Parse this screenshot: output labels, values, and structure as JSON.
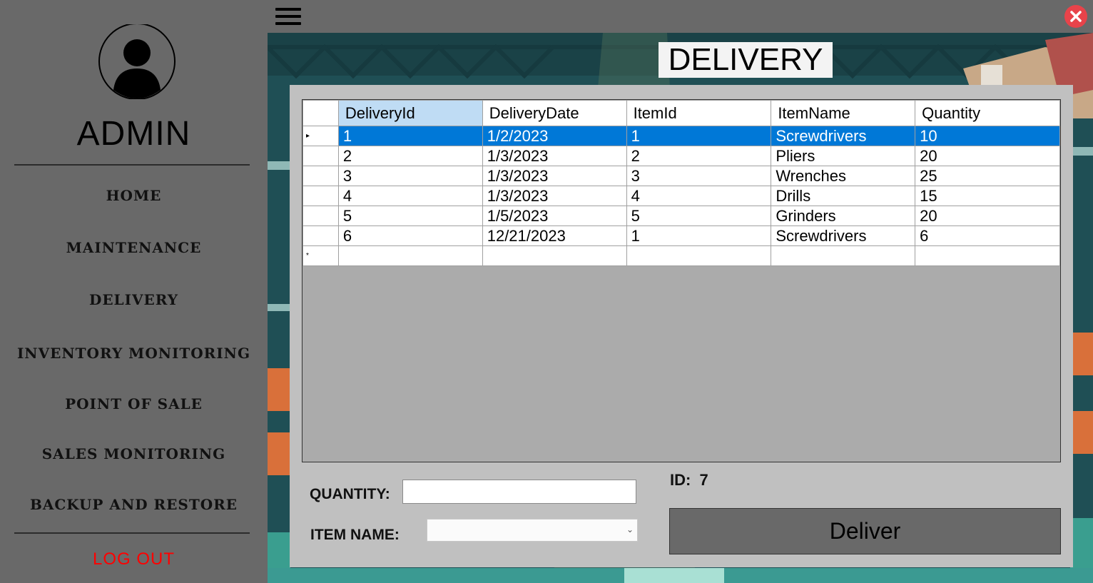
{
  "sidebar": {
    "role": "ADMIN",
    "nav": [
      {
        "label": "HOME"
      },
      {
        "label": "MAINTENANCE"
      },
      {
        "label": "DELIVERY"
      },
      {
        "label": "INVENTORY MONITORING"
      },
      {
        "label": "POINT OF SALE"
      },
      {
        "label": "SALES MONITORING"
      },
      {
        "label": "BACKUP AND RESTORE"
      }
    ],
    "logout": "LOG OUT"
  },
  "header": {
    "title": "DELIVERY"
  },
  "grid": {
    "columns": [
      "DeliveryId",
      "DeliveryDate",
      "ItemId",
      "ItemName",
      "Quantity"
    ],
    "sorted_column": "DeliveryId",
    "selected_row": 0,
    "rows": [
      [
        "1",
        "1/2/2023",
        "1",
        "Screwdrivers",
        "10"
      ],
      [
        "2",
        "1/3/2023",
        "2",
        "Pliers",
        "20"
      ],
      [
        "3",
        "1/3/2023",
        "3",
        "Wrenches",
        "25"
      ],
      [
        "4",
        "1/3/2023",
        "4",
        "Drills",
        "15"
      ],
      [
        "5",
        "1/5/2023",
        "5",
        "Grinders",
        "20"
      ],
      [
        "6",
        "12/21/2023",
        "1",
        "Screwdrivers",
        "6"
      ]
    ],
    "current_row_marker": "▸",
    "new_row_marker": "*"
  },
  "form": {
    "quantity_label": "QUANTITY:",
    "quantity_value": "",
    "item_name_label": "ITEM NAME:",
    "item_name_value": "",
    "id_label": "ID:",
    "id_value": "7",
    "deliver_label": "Deliver"
  },
  "icons": {
    "menu": "hamburger-icon",
    "close": "close-icon",
    "avatar": "user-avatar-icon",
    "dropdown": "chevron-down-icon"
  },
  "colors": {
    "sidebar_bg": "#696969",
    "selected_row": "#0078d7",
    "sorted_header": "#bfdcf4",
    "logout": "#ff0000",
    "close_button": "#e8434a"
  }
}
